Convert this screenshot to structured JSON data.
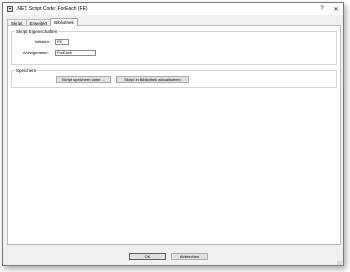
{
  "window": {
    "title": ".NET Script Code: ForEach (FE)",
    "help_button": "?",
    "close_button": "✕"
  },
  "tabs": [
    {
      "label": "Skript",
      "active": false
    },
    {
      "label": "Erweitert",
      "active": false
    },
    {
      "label": "Bibliothek",
      "active": true
    }
  ],
  "properties": {
    "group_title": "Skript Eigenschaften",
    "initials_label": "Initialen:",
    "initials_value": "FE",
    "display_name_label": "Anzeigename:",
    "display_name_value": "ForEach"
  },
  "save": {
    "group_title": "Speichern",
    "save_as_button": "Skript speichern unter ...",
    "update_library_button": "Skript in Bibliothek aktualisieren"
  },
  "footer": {
    "ok_button": "OK",
    "cancel_button": "Abbrechen"
  },
  "colors": {
    "accent": "#0078d7",
    "window_bg": "#f0f0f0"
  }
}
